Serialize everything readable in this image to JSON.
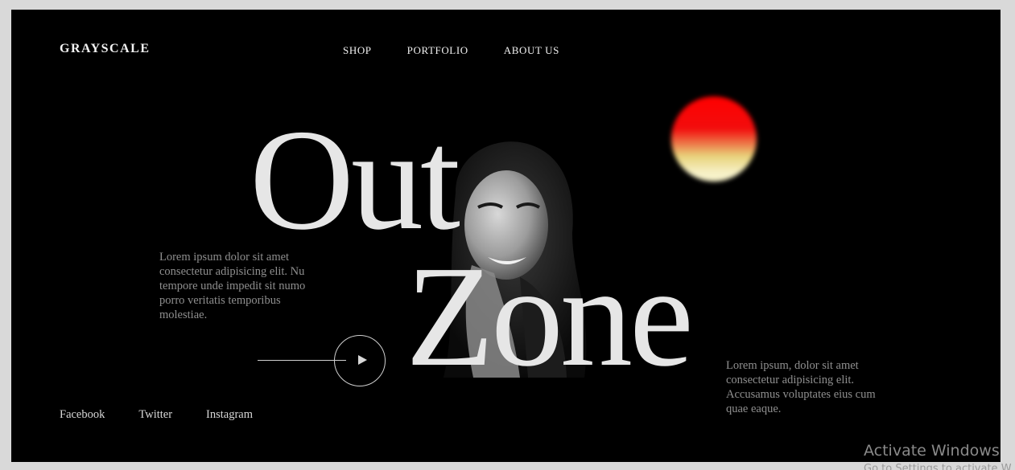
{
  "brand": {
    "logo": "GRAYSCALE"
  },
  "nav": {
    "items": [
      "SHOP",
      "PORTFOLIO",
      "ABOUT US"
    ]
  },
  "hero": {
    "title_line1": "Out",
    "title_line2": "Zone",
    "intro_lines": [
      "Lorem ipsum dolor sit amet",
      "consectetur adipisicing elit. Nu",
      "tempore unde impedit sit numo",
      "porro veritatis temporibus",
      "molestiae."
    ],
    "side_text": "Lorem ipsum, dolor sit amet consectetur adipisicing elit. Accusamus voluptates eius cum quae eaque."
  },
  "socials": [
    "Facebook",
    "Twitter",
    "Instagram"
  ],
  "colors": {
    "background": "#000000",
    "accent_red": "#ff0000",
    "accent_cream": "#f7f2c9",
    "text_muted": "#8f8f8f"
  },
  "os_watermark": {
    "title": "Activate Windows",
    "subtitle": "Go to Settings to activate W"
  }
}
